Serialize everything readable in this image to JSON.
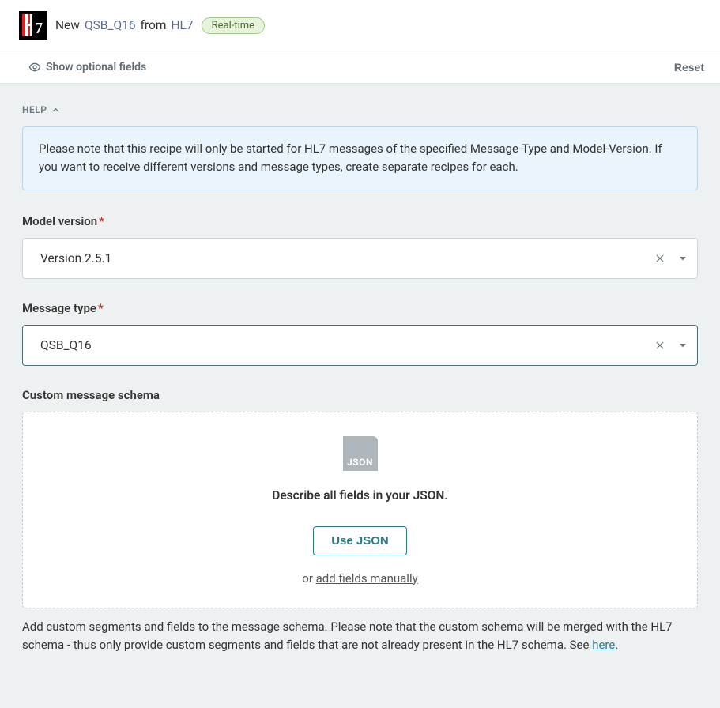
{
  "header": {
    "new_label": "New",
    "recipe_name": "QSB_Q16",
    "from_label": "from",
    "app_name": "HL7",
    "badge": "Real-time"
  },
  "toolbar": {
    "show_optional": "Show optional fields",
    "reset": "Reset"
  },
  "help": {
    "label": "HELP",
    "text": "Please note that this recipe will only be started for HL7 messages of the specified Message-Type and Model-Version. If you want to receive different versions and message types, create separate recipes for each."
  },
  "fields": {
    "model_version": {
      "label": "Model version",
      "value": "Version 2.5.1"
    },
    "message_type": {
      "label": "Message type",
      "value": "QSB_Q16"
    },
    "custom_schema": {
      "label": "Custom message schema",
      "json_badge": "JSON",
      "describe": "Describe all fields in your JSON.",
      "use_json": "Use JSON",
      "or": "or ",
      "add_manually": "add fields manually",
      "note_prefix": "Add custom segments and fields to the message schema. Please note that the custom schema will be merged with the HL7 schema - thus only provide custom segments and fields that are not already present in the HL7 schema. See ",
      "note_link": "here",
      "note_suffix": "."
    }
  }
}
